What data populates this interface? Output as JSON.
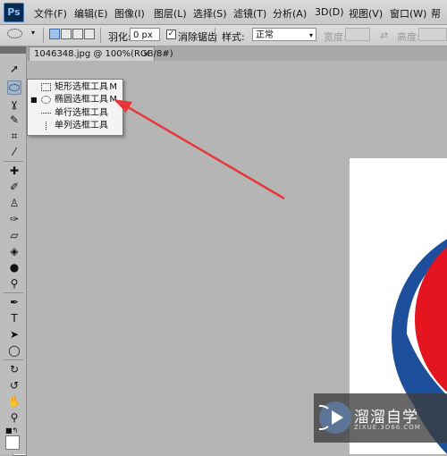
{
  "app": {
    "logo": "Ps"
  },
  "menu": [
    "文件(F)",
    "编辑(E)",
    "图像(I)",
    "图层(L)",
    "选择(S)",
    "滤镜(T)",
    "分析(A)",
    "3D(D)",
    "视图(V)",
    "窗口(W)",
    "帮"
  ],
  "options": {
    "feather_label": "羽化:",
    "feather_value": "0 px",
    "antialias_label": "消除锯齿",
    "style_label": "样式:",
    "style_value": "正常",
    "width_label": "宽度:",
    "height_label": "高度:"
  },
  "document": {
    "tab_title": "1046348.jpg @ 100%(RGB/8#)",
    "close": "×"
  },
  "flyout": [
    {
      "label": "矩形选框工具",
      "shortcut": "M",
      "icon": "rect-marquee-icon",
      "selected": false
    },
    {
      "label": "椭圆选框工具",
      "shortcut": "M",
      "icon": "ellipse-marquee-icon",
      "selected": true
    },
    {
      "label": "单行选框工具",
      "shortcut": "",
      "icon": "single-row-marquee-icon",
      "selected": false
    },
    {
      "label": "单列选框工具",
      "shortcut": "",
      "icon": "single-column-marquee-icon",
      "selected": false
    }
  ],
  "watermark": {
    "title": "溜溜自学",
    "subtitle": "ZIXUE.3D66.COM"
  },
  "colors": {
    "arrow": "#e8373a",
    "pepsi_red": "#e4151f",
    "pepsi_blue": "#1d4f9c"
  }
}
